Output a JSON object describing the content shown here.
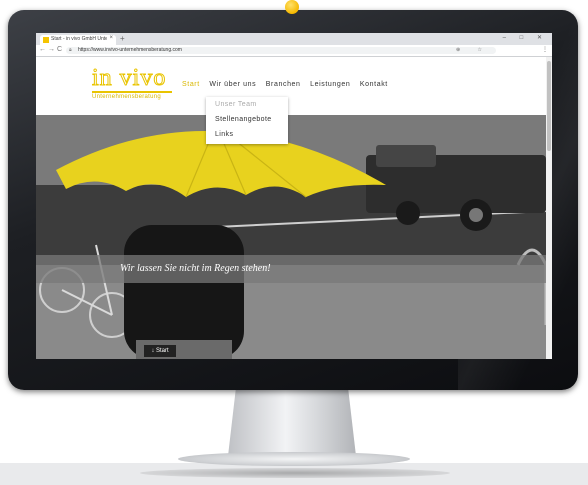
{
  "browser": {
    "tab_title": "Start - in vivo GmbH Unternehm",
    "tab_close": "×",
    "new_tab": "+",
    "window_controls": "– □ ✕",
    "back": "←",
    "forward": "→",
    "reload": "C",
    "url": "https://www.invivo-unternehmensberatung.com",
    "omnibox_icons": "⊕ ☆",
    "menu": "⋮"
  },
  "site": {
    "logo_text": "in vivo",
    "logo_subtitle": "Unternehmensberatung",
    "nav": [
      {
        "label": "Start",
        "active": true
      },
      {
        "label": "Wir über uns"
      },
      {
        "label": "Branchen"
      },
      {
        "label": "Leistungen"
      },
      {
        "label": "Kontakt"
      }
    ],
    "dropdown": [
      "Unser Team",
      "Stellenangebote",
      "Links"
    ],
    "hero_caption": "Wir lassen Sie nicht im Regen stehen!",
    "start_button": "↓ Start"
  },
  "colors": {
    "accent": "#e9c400",
    "umbrella": "#e8d21e",
    "monitor_bezel": "#1d1f23"
  }
}
